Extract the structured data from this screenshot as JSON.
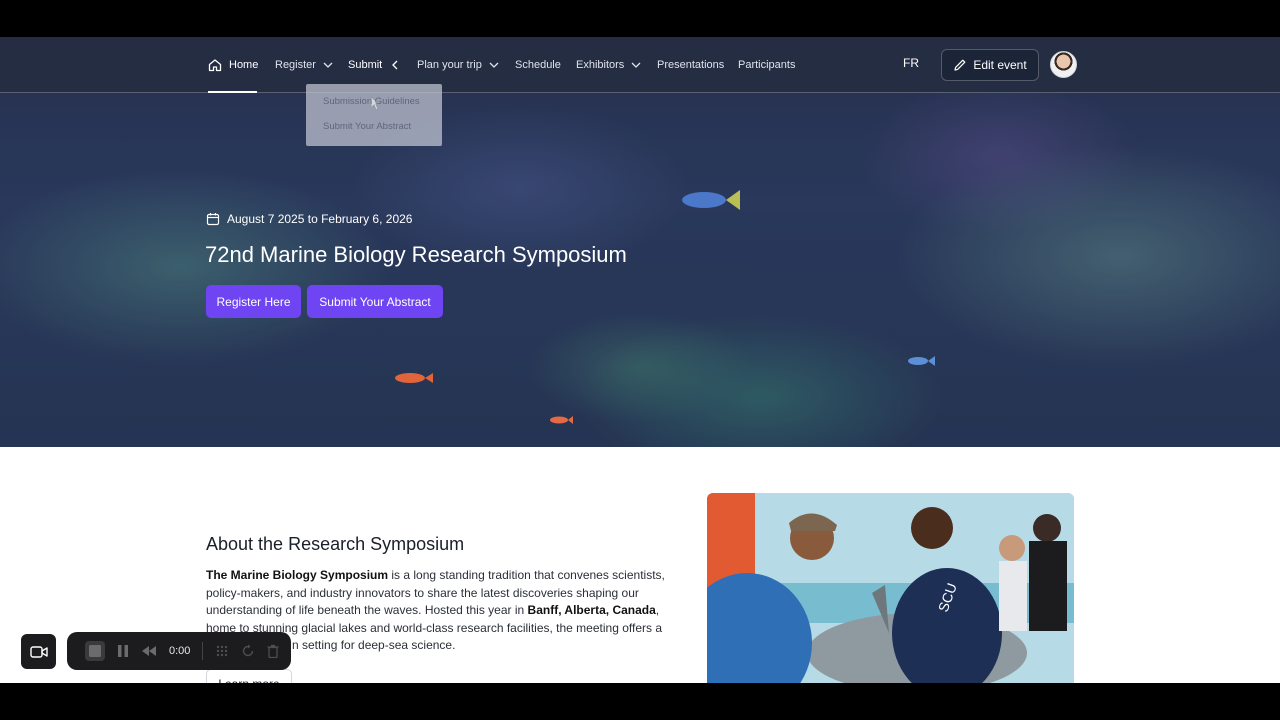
{
  "nav": {
    "items": [
      {
        "label": "Home"
      },
      {
        "label": "Register"
      },
      {
        "label": "Submit"
      },
      {
        "label": "Plan your trip"
      },
      {
        "label": "Schedule"
      },
      {
        "label": "Exhibitors"
      },
      {
        "label": "Presentations"
      },
      {
        "label": "Participants"
      }
    ],
    "language": "FR",
    "edit_label": "Edit event"
  },
  "submit_dropdown": {
    "items": [
      "Submission Guidelines",
      "Submit Your Abstract"
    ]
  },
  "hero": {
    "date": "August 7 2025 to February 6, 2026",
    "title": "72nd Marine Biology Research Symposium",
    "register_label": "Register Here",
    "submit_label": "Submit Your Abstract"
  },
  "about": {
    "title": "About the Research Symposium",
    "p1_bold": "The Marine Biology Symposium",
    "p1_text": " is a long standing tradition that convenes scientists, policy-makers, and industry innovators to share the latest discoveries shaping our understanding of life beneath the waves. Hosted this year in ",
    "location_bold": "Banff, Alberta, Canada",
    "p1_tail": ", home to stunning glacial lakes and world-class research facilities, the meeting offers a",
    "p1_end": "n setting for deep-sea science.",
    "learn_more": "Learn more"
  },
  "recorder": {
    "time": "0:00"
  }
}
